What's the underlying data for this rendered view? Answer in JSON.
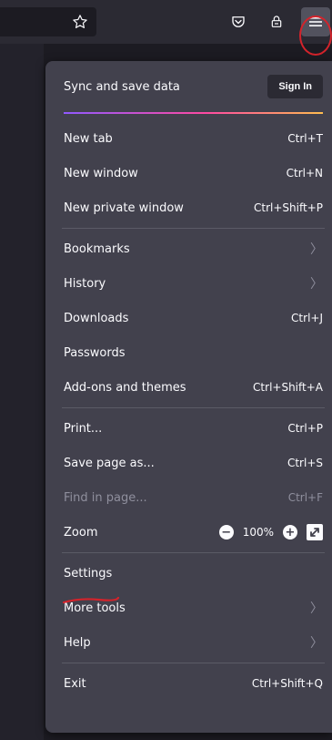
{
  "menu": {
    "sync_label": "Sync and save data",
    "signin_label": "Sign In",
    "items": [
      {
        "label": "New tab",
        "shortcut": "Ctrl+T"
      },
      {
        "label": "New window",
        "shortcut": "Ctrl+N"
      },
      {
        "label": "New private window",
        "shortcut": "Ctrl+Shift+P"
      },
      {
        "label": "Bookmarks"
      },
      {
        "label": "History"
      },
      {
        "label": "Downloads",
        "shortcut": "Ctrl+J"
      },
      {
        "label": "Passwords"
      },
      {
        "label": "Add-ons and themes",
        "shortcut": "Ctrl+Shift+A"
      },
      {
        "label": "Print...",
        "shortcut": "Ctrl+P"
      },
      {
        "label": "Save page as...",
        "shortcut": "Ctrl+S"
      },
      {
        "label": "Find in page...",
        "shortcut": "Ctrl+F"
      },
      {
        "label": "Zoom"
      },
      {
        "label": "Settings"
      },
      {
        "label": "More tools"
      },
      {
        "label": "Help"
      },
      {
        "label": "Exit",
        "shortcut": "Ctrl+Shift+Q"
      }
    ],
    "zoom": {
      "minus": "−",
      "value": "100%",
      "plus": "+"
    }
  },
  "toolbar": {
    "icons": [
      "bookmark-star-icon",
      "pocket-icon",
      "extension-icon",
      "hamburger-menu-icon"
    ]
  },
  "colors": {
    "panel": "#42414d",
    "toolbar": "#2b2a33",
    "text": "#fbfbfe",
    "disabled": "#8f8f9d",
    "annotation": "#d4232b"
  }
}
